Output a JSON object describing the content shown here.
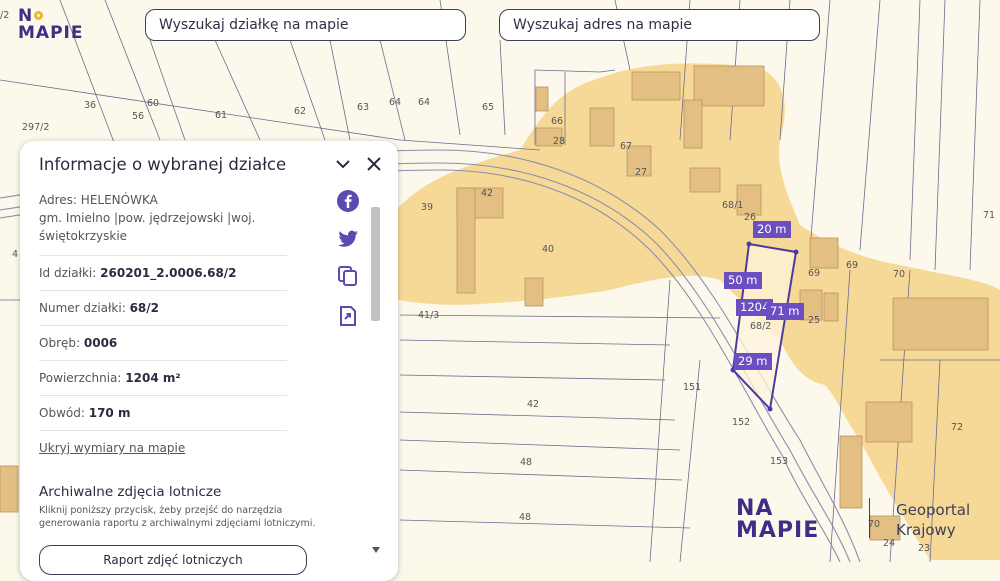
{
  "search": {
    "parcel_label": "Wyszukaj działkę na mapie",
    "address_label": "Wyszukaj adres na mapie"
  },
  "logo": {
    "line1_a": "N",
    "line1_b": "",
    "line2": "MAPIE"
  },
  "panel": {
    "title": "Informacje o wybranej działce",
    "address_label": "Adres:",
    "address_value": "HELENÓWKA",
    "address_line2": "gm. Imielno |pow. jędrzejowski |woj.",
    "address_line3": "świętokrzyskie",
    "id_label": "Id działki:",
    "id_value": "260201_2.0006.68/2",
    "number_label": "Numer działki:",
    "number_value": "68/2",
    "obreb_label": "Obręb:",
    "obreb_value": "0006",
    "area_label": "Powierzchnia:",
    "area_value": "1204 m²",
    "perimeter_label": "Obwód:",
    "perimeter_value": "170 m",
    "hide_dimensions_link": "Ukryj wymiary na mapie",
    "archive_title": "Archiwalne zdjęcia lotnicze",
    "archive_desc_1": "Kliknij poniższy przycisk, żeby przejść do narzędzia",
    "archive_desc_2": "generowania raportu z archiwalnymi zdjęciami lotniczymi.",
    "report_button": "Raport zdjęć lotniczych"
  },
  "icons": {
    "collapse": "chevron-down-icon",
    "close": "close-icon",
    "facebook": "facebook-icon",
    "twitter": "twitter-icon",
    "copy": "copy-icon",
    "export": "export-icon"
  },
  "measurements": {
    "top": "20 m",
    "left": "50 m",
    "right": "71 m",
    "bottom": "29 m",
    "area": "1204"
  },
  "map_labels": {
    "n_36": "36",
    "n_60": "60",
    "n_61": "61",
    "n_62": "62",
    "n_63": "63",
    "n_64a": "64",
    "n_64b": "64",
    "n_65": "65",
    "n_66": "66",
    "n_28": "28",
    "n_67": "67",
    "n_27": "27",
    "n_42a": "42",
    "n_39": "39",
    "n_40": "40",
    "n_41_3": "41/3",
    "n_68_1": "68/1",
    "n_26": "26",
    "n_69a": "69",
    "n_69b": "69",
    "n_70a": "70",
    "n_71": "71",
    "n_68_2": "68/2",
    "n_25": "25",
    "n_151": "151",
    "n_152": "152",
    "n_153": "153",
    "n_42b": "42",
    "n_48a": "48",
    "n_48b": "48",
    "n_72": "72",
    "n_297_2": "297/2",
    "n_2": "/2",
    "n_4": "4",
    "n_70b": "70",
    "n_24": "24",
    "n_23": "23",
    "n_56": "56"
  },
  "brand": {
    "logo_top": "NA",
    "logo_bottom": "MAPIE",
    "geoportal_1": "Geoportal",
    "geoportal_2": "Krajowy"
  },
  "colors": {
    "accent": "#6b4fc2",
    "zone": "#f6d488",
    "logo": "#3d2f86",
    "logo_dot": "#f0b52a"
  }
}
